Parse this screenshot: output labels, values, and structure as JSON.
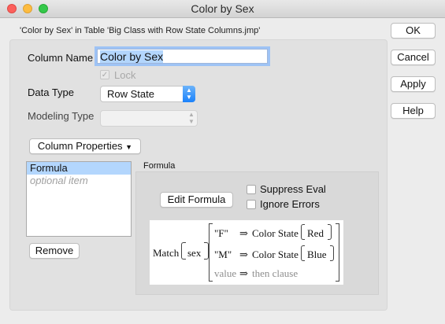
{
  "window": {
    "title": "Color by Sex"
  },
  "subtitle": "'Color by Sex' in Table 'Big Class with Row State Columns.jmp'",
  "column_name": {
    "label": "Column Name",
    "value": "Color by Sex"
  },
  "lock": {
    "label": "Lock",
    "checked": true
  },
  "data_type": {
    "label": "Data Type",
    "value": "Row State"
  },
  "modeling_type": {
    "label": "Modeling Type",
    "value": ""
  },
  "column_properties": {
    "label": "Column Properties"
  },
  "properties_list": {
    "items": [
      "Formula"
    ],
    "placeholder": "optional item"
  },
  "remove_label": "Remove",
  "formula": {
    "section_label": "Formula",
    "edit_label": "Edit Formula",
    "suppress_eval": "Suppress Eval",
    "ignore_errors": "Ignore Errors",
    "match": "Match",
    "arg": "sex",
    "rows": [
      {
        "key": "\"F\"",
        "arrow": "⇒",
        "result": "Color State",
        "value": "Red"
      },
      {
        "key": "\"M\"",
        "arrow": "⇒",
        "result": "Color State",
        "value": "Blue"
      }
    ],
    "else_key": "value",
    "else_arrow": "⇒",
    "else_result": "then clause"
  },
  "buttons": {
    "ok": "OK",
    "cancel": "Cancel",
    "apply": "Apply",
    "help": "Help"
  }
}
